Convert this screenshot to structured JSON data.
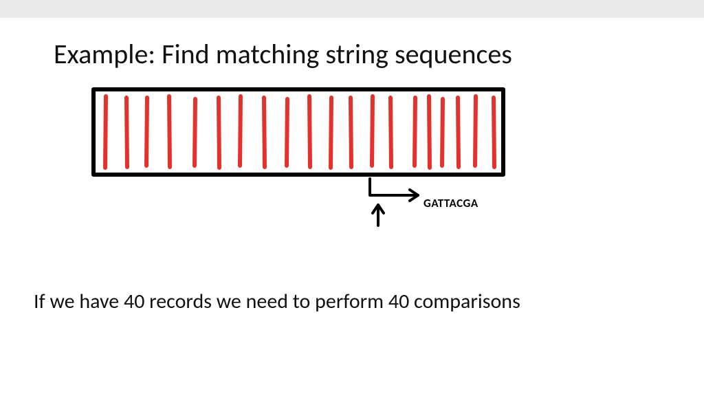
{
  "title": "Example: Find matching string sequences",
  "annotation_label": "GATTACGA",
  "body_text": "If we have 40 records we need to perform 40 comparisons",
  "colors": {
    "bar_stroke": "#e4312b",
    "box_stroke": "#000000",
    "arrow_stroke": "#000000"
  },
  "bars": {
    "count": 20,
    "positions": [
      22,
      52,
      82,
      114,
      152,
      186,
      218,
      252,
      286,
      318,
      350,
      378,
      410,
      436,
      472,
      492,
      512,
      534,
      560,
      586
    ]
  }
}
